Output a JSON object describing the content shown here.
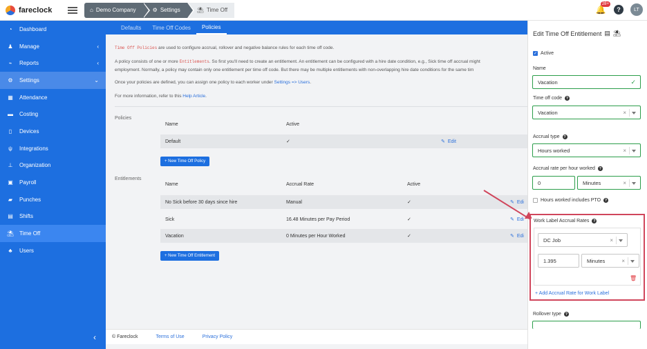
{
  "app": {
    "name": "fareclock"
  },
  "breadcrumb": [
    {
      "label": "Demo Company",
      "icon": "home-icon"
    },
    {
      "label": "Settings",
      "icon": "gear-icon"
    },
    {
      "label": "Time Off",
      "icon": "beach-umbrella-icon"
    }
  ],
  "header": {
    "notification_count": "28+",
    "help": "?",
    "avatar_initials": "LT"
  },
  "sidebar": {
    "items": [
      {
        "label": "Dashboard",
        "icon": "dashboard-icon"
      },
      {
        "label": "Manage",
        "icon": "person-icon",
        "arrow": "‹"
      },
      {
        "label": "Reports",
        "icon": "chart-icon",
        "arrow": "‹"
      },
      {
        "label": "Settings",
        "icon": "gear-icon",
        "arrow": "⌄"
      },
      {
        "label": "Attendance",
        "icon": "calendar-icon"
      },
      {
        "label": "Costing",
        "icon": "folder-icon"
      },
      {
        "label": "Devices",
        "icon": "tablet-icon"
      },
      {
        "label": "Integrations",
        "icon": "plug-icon"
      },
      {
        "label": "Organization",
        "icon": "org-chart-icon"
      },
      {
        "label": "Payroll",
        "icon": "money-icon"
      },
      {
        "label": "Punches",
        "icon": "car-icon"
      },
      {
        "label": "Shifts",
        "icon": "briefcase-icon"
      },
      {
        "label": "Time Off",
        "icon": "beach-umbrella-icon"
      },
      {
        "label": "Users",
        "icon": "users-icon"
      }
    ],
    "collapse": "‹"
  },
  "tabs": [
    "Defaults",
    "Time Off Codes",
    "Policies"
  ],
  "intro": {
    "p1_code": "Time Off Policies",
    "p1_rest": " are used to configure accrual, rollover and negative balance rules for each time off code.",
    "p2_a": "A policy consists of one or more ",
    "p2_code": "Entitlements",
    "p2_b": ". So first you'll need to create an entitlement. An entitlement can be configured with a hire date condition, e.g., Sick time off accrual might",
    "p2_c": "employment. Normally, a policy may contain only one entitlement per time off code. But there may be multiple entitlements with non-overlapping hire date conditions for the same tim",
    "p3_a": "Once your policies are defined, you can assign one policy to each worker under ",
    "p3_link": "Settings => Users",
    "p3_b": ".",
    "p4_a": "For more information, refer to this ",
    "p4_link": "Help Article",
    "p4_b": "."
  },
  "policies": {
    "section_label": "Policies",
    "headers": [
      "Name",
      "Active"
    ],
    "rows": [
      {
        "name": "Default",
        "active": "✓",
        "edit": "Edit"
      }
    ],
    "new_button": "+ New Time Off Policy"
  },
  "entitlements": {
    "section_label": "Entitlements",
    "headers": [
      "Name",
      "Accrual Rate",
      "Active"
    ],
    "rows": [
      {
        "name": "No Sick before 30 days since hire",
        "rate": "Manual",
        "active": "✓",
        "edit": "Edi"
      },
      {
        "name": "Sick",
        "rate": "16.48 Minutes per Pay Period",
        "active": "✓",
        "edit": "Edi"
      },
      {
        "name": "Vacation",
        "rate": "0 Minutes per Hour Worked",
        "active": "✓",
        "edit": "Edi"
      }
    ],
    "new_button": "+ New Time Off Entitlement"
  },
  "footer": {
    "copyright": "© Fareclock",
    "terms": "Terms of Use",
    "privacy": "Privacy Policy"
  },
  "panel": {
    "title": "Edit Time Off Entitlement",
    "active_label": "Active",
    "name_label": "Name",
    "name_value": "Vacation",
    "code_label": "Time off code",
    "code_value": "Vacation",
    "accrual_type_label": "Accrual type",
    "accrual_type_value": "Hours worked",
    "accrual_rate_label": "Accrual rate per hour worked",
    "accrual_rate_value": "0",
    "accrual_rate_unit": "Minutes",
    "includes_pto_a": "Hours ",
    "includes_pto_em": "worked",
    "includes_pto_b": " includes PTO",
    "work_label_title": "Work Label Accrual Rates",
    "work_label_value": "DC Job",
    "work_label_rate": "1.395",
    "work_label_unit": "Minutes",
    "add_rate": "+ Add Accrual Rate for Work Label",
    "rollover_label": "Rollover type"
  },
  "colors": {
    "brand_blue": "#1d6fe0",
    "highlight_red": "#d0455b",
    "valid_green": "#2a9d49"
  }
}
